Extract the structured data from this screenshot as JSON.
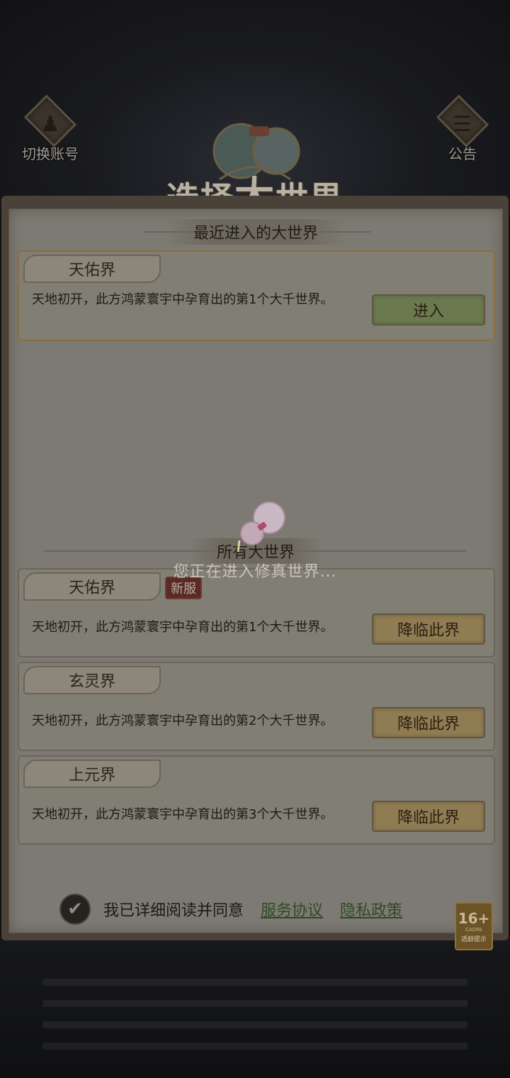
{
  "header": {
    "switch_account_label": "切换账号",
    "announcement_label": "公告",
    "title_part1": "选择",
    "title_big": "大",
    "title_part2": "世界"
  },
  "recent": {
    "section_title": "最近进入的大世界",
    "world": {
      "name": "天佑界",
      "description": "天地初开，此方鸿蒙寰宇中孕育出的第1个大千世界。",
      "button_label": "进入"
    }
  },
  "all_worlds": {
    "section_title": "所有大世界",
    "items": [
      {
        "name": "天佑界",
        "badge": "新服",
        "description": "天地初开，此方鸿蒙寰宇中孕育出的第1个大千世界。",
        "button_label": "降临此界"
      },
      {
        "name": "玄灵界",
        "badge": "",
        "description": "天地初开，此方鸿蒙寰宇中孕育出的第2个大千世界。",
        "button_label": "降临此界"
      },
      {
        "name": "上元界",
        "badge": "",
        "description": "天地初开，此方鸿蒙寰宇中孕育出的第3个大千世界。",
        "button_label": "降临此界"
      }
    ]
  },
  "loading": {
    "message": "您正在进入修真世界..."
  },
  "agreement": {
    "text": "我已详细阅读并同意",
    "service_link": "服务协议",
    "privacy_link": "隐私政策"
  },
  "age_rating": {
    "age": "16+",
    "org": "CADPA",
    "hint": "适龄提示"
  },
  "colors": {
    "link": "#2f4a26",
    "enter_button": "#6b7a4e",
    "descend_button": "#8f7c53"
  }
}
